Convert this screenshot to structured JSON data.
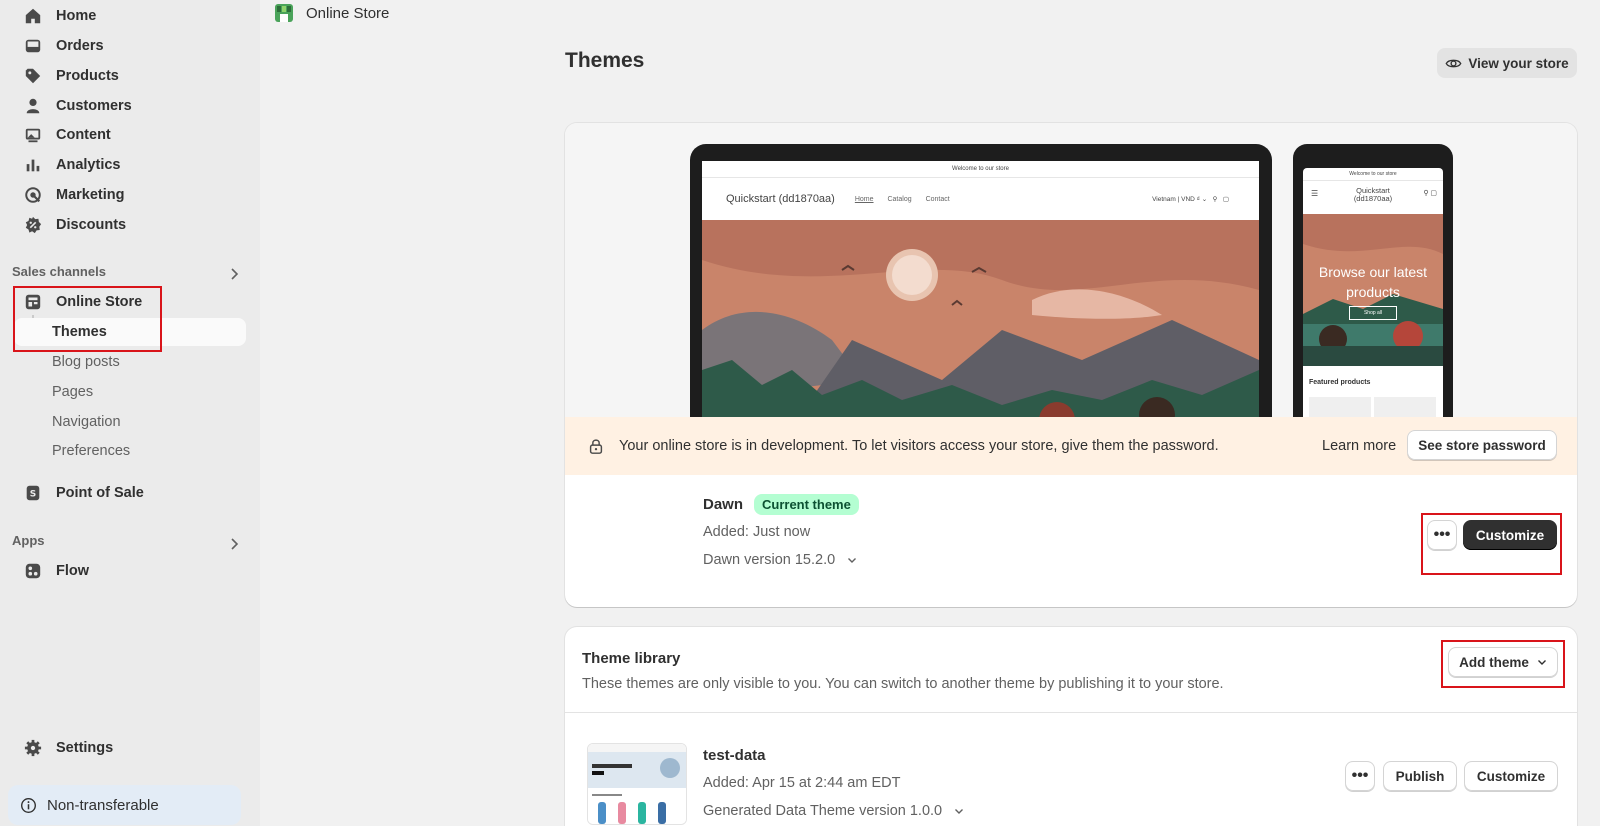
{
  "sidebar": {
    "nav": [
      {
        "label": "Home",
        "icon": "home-icon"
      },
      {
        "label": "Orders",
        "icon": "inbox-icon"
      },
      {
        "label": "Products",
        "icon": "tag-icon"
      },
      {
        "label": "Customers",
        "icon": "person-icon"
      },
      {
        "label": "Content",
        "icon": "image-icon"
      },
      {
        "label": "Analytics",
        "icon": "bar-chart-icon"
      },
      {
        "label": "Marketing",
        "icon": "target-icon"
      },
      {
        "label": "Discounts",
        "icon": "discount-icon"
      }
    ],
    "sales_channels_label": "Sales channels",
    "online_store": "Online Store",
    "online_store_subitems": [
      "Themes",
      "Blog posts",
      "Pages",
      "Navigation",
      "Preferences"
    ],
    "point_of_sale": "Point of Sale",
    "apps_label": "Apps",
    "flow": "Flow",
    "settings": "Settings",
    "non_transferable": "Non-transferable"
  },
  "breadcrumb": {
    "label": "Online Store"
  },
  "page": {
    "title": "Themes",
    "view_store": "View your store"
  },
  "preview": {
    "desktop_announcement": "Welcome to our store",
    "store_name": "Quickstart (dd1870aa)",
    "desktop_links": [
      "Home",
      "Catalog",
      "Contact"
    ],
    "desktop_region": "Vietnam | VND ₫",
    "mobile_announcement": "Welcome to our store",
    "mobile_store_name_line1": "Quickstart",
    "mobile_store_name_line2": "(dd1870aa)",
    "mobile_hero_line1": "Browse our latest",
    "mobile_hero_line2": "products",
    "mobile_hero_button": "Shop all",
    "mobile_featured": "Featured products"
  },
  "banner": {
    "message": "Your online store is in development. To let visitors access your store, give them the password.",
    "learn_more": "Learn more",
    "see_password": "See store password"
  },
  "current_theme": {
    "name": "Dawn",
    "badge": "Current theme",
    "added": "Added: Just now",
    "version": "Dawn version 15.2.0",
    "customize": "Customize"
  },
  "library": {
    "title": "Theme library",
    "description": "These themes are only visible to you. You can switch to another theme by publishing it to your store.",
    "add_theme": "Add theme",
    "themes": [
      {
        "name": "test-data",
        "added": "Added: Apr 15 at 2:44 am EDT",
        "version": "Generated Data Theme version 1.0.0",
        "publish": "Publish",
        "customize": "Customize"
      }
    ]
  },
  "colors": {
    "highlight_red": "#d9141a",
    "badge_green": "#b4fed2",
    "banner_bg": "#fff1e3",
    "primary_dark": "#303030"
  }
}
